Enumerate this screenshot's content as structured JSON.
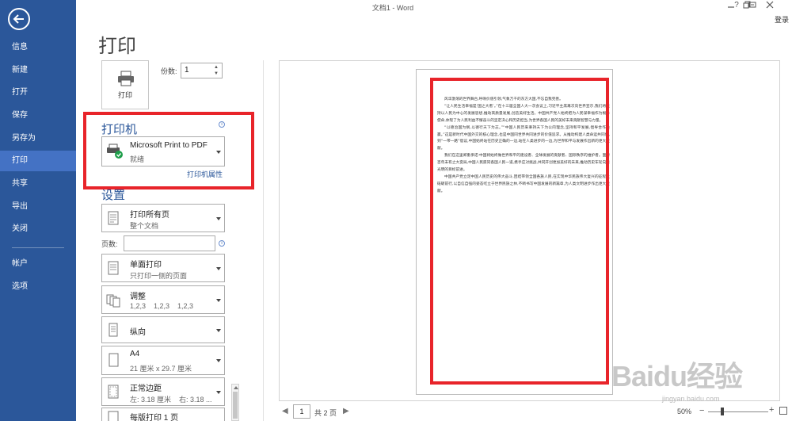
{
  "window": {
    "title": "文档1 - Word",
    "help": "?",
    "signin": "登录"
  },
  "sidebar": {
    "items": [
      {
        "label": "信息"
      },
      {
        "label": "新建"
      },
      {
        "label": "打开"
      },
      {
        "label": "保存"
      },
      {
        "label": "另存为"
      },
      {
        "label": "打印",
        "active": true
      },
      {
        "label": "共享"
      },
      {
        "label": "导出"
      },
      {
        "label": "关闭"
      },
      {
        "label": "帐户"
      },
      {
        "label": "选项"
      }
    ]
  },
  "print": {
    "title": "打印",
    "button_label": "打印",
    "copies_label": "份数:",
    "copies_value": "1",
    "printer_heading": "打印机",
    "printer_name": "Microsoft Print to PDF",
    "printer_status": "就绪",
    "printer_properties": "打印机属性",
    "settings_heading": "设置",
    "pages_label": "页数:",
    "settings": [
      {
        "line1": "打印所有页",
        "line2": "整个文档"
      },
      {
        "line1": "单面打印",
        "line2": "只打印一侧的页面"
      },
      {
        "line1": "调整",
        "line2": "1,2,3    1,2,3    1,2,3"
      },
      {
        "line1": "纵向",
        "line2": ""
      },
      {
        "line1": "A4",
        "line2": "21 厘米 x 29.7 厘米"
      },
      {
        "line1": "正常边距",
        "line2": "左: 3.18 厘米    右: 3.18 ..."
      },
      {
        "line1": "每版打印 1 页",
        "line2": ""
      }
    ]
  },
  "preview": {
    "paragraphs": [
      "风华激荡的世界舞台,呼唤价值引领,气象万千的东方大国,不忘自我完善。",
      "“让人民生活幸福是‘国之大者’。”在十三届全国人大一次会议上,习近平主席再次向世界宣示,我们将坚持以人民为中心的发展思想,推动高质量发展,创造美好生活。中国共产党人始终把为人民谋幸福作为根本使命,体现了为人民利益不懈奋斗的坚定决心和历史担当,为世界各国人民的美好未来贡献智慧与力量。",
      "“以德治国为纲,以德行天下为志。”“中国人民历来秉持天下为公的理念,坚持和平发展,倡导合作共赢。”这是新时代中国外交的核心理念,也是中国同世界共同进步的价值追求。从推动构建人类命运共同体,到“一带一路”倡议,中国始终站在历史正确的一边,站在人类进步的一边,为世界和平与发展作出新的更大贡献。",
      "我们在这里郑重承诺:中国将始终做世界和平的建设者、全球发展的贡献者、国际秩序的维护者。面对百年未有之大变局,中国人民愿同各国人民一道,携手应对挑战,共同开创更加美好的未来,推动历史车轮向着光明的目标前进。",
      "中国共产党立足中国人民历史的伟大奋斗,团结带领全国各族人民,在实现中华民族伟大复兴的征程上砥砺前行,以自信自强的姿态屹立于世界民族之林,不断书写中国发展的新篇章,为人类文明进步作出更大贡献。"
    ],
    "page_current": "1",
    "page_total": "共 2 页",
    "zoom": "50%"
  },
  "watermark": {
    "text": "Baidu经验",
    "sub": "jingyan.baidu.com"
  }
}
